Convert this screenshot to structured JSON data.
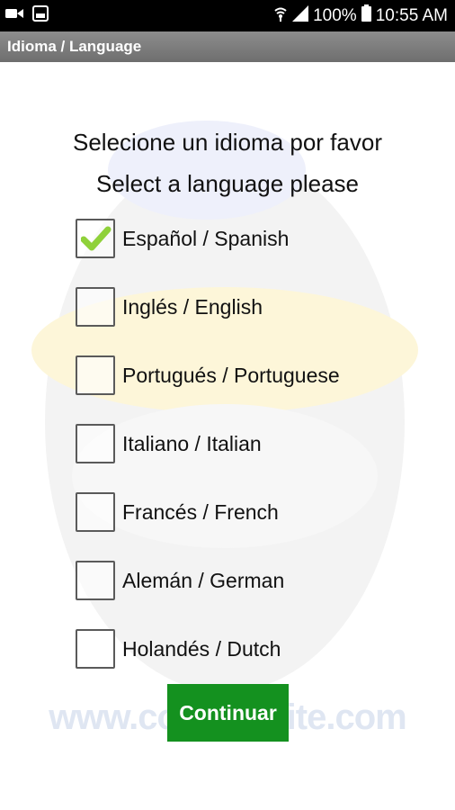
{
  "status_bar": {
    "battery_percent": "100%",
    "time": "10:55 AM",
    "icons": [
      "video-camera-icon",
      "screenshot-icon",
      "wifi-icon",
      "signal-icon",
      "battery-icon"
    ]
  },
  "app_bar": {
    "title": "Idioma / Language"
  },
  "watermark": {
    "url_text": "www.com          plesite.com"
  },
  "prompt": {
    "line1": "Selecione un idioma por favor",
    "line2": "Select a language please"
  },
  "languages": [
    {
      "label": "Español / Spanish",
      "checked": true
    },
    {
      "label": "Inglés / English",
      "checked": false
    },
    {
      "label": "Portugués / Portuguese",
      "checked": false
    },
    {
      "label": "Italiano / Italian",
      "checked": false
    },
    {
      "label": "Francés / French",
      "checked": false
    },
    {
      "label": "Alemán / German",
      "checked": false
    },
    {
      "label": "Holandés / Dutch",
      "checked": false
    }
  ],
  "continue_label": "Continuar",
  "colors": {
    "accent": "#14911f",
    "check": "#8fd13a"
  }
}
